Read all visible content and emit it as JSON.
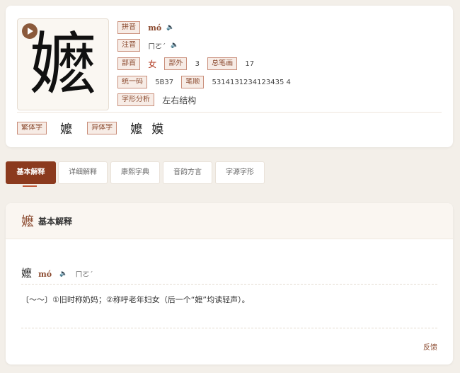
{
  "character": "嬷",
  "info": {
    "pinyin_label": "拼音",
    "pinyin": "mó",
    "zhuyin_label": "注音",
    "zhuyin": "ㄇㄛˊ",
    "radical_label": "部首",
    "radical": "女",
    "outer_strokes_label": "部外",
    "outer_strokes": "3",
    "total_strokes_label": "总笔画",
    "total_strokes": "17",
    "unicode_label": "统一码",
    "unicode": "5B37",
    "stroke_order_label": "笔顺",
    "stroke_order": "5314131234123435 4",
    "structure_label": "字形分析",
    "structure": "左右结构"
  },
  "variants": {
    "traditional_label": "繁体字",
    "traditional": "嬤",
    "alternate_label": "异体字",
    "alternates": [
      "嬤",
      "嫫"
    ]
  },
  "tabs": [
    {
      "label": "基本解释",
      "active": true
    },
    {
      "label": "详细解释",
      "active": false
    },
    {
      "label": "康熙字典",
      "active": false
    },
    {
      "label": "音韵方言",
      "active": false
    },
    {
      "label": "字源字形",
      "active": false
    }
  ],
  "basic": {
    "title": "基本解释",
    "pinyin": "mó",
    "zhuyin": "ㄇㄛˊ",
    "definition": "〔～～〕①旧时称奶妈；②称呼老年妇女（后一个“嬷”均读轻声）。",
    "feedback": "反馈"
  },
  "icons": {
    "play": "play-icon",
    "speaker": "speaker-icon"
  },
  "colors": {
    "accent": "#8b3a1e",
    "tag_border": "#c98e7a",
    "background": "#f3efe9"
  }
}
